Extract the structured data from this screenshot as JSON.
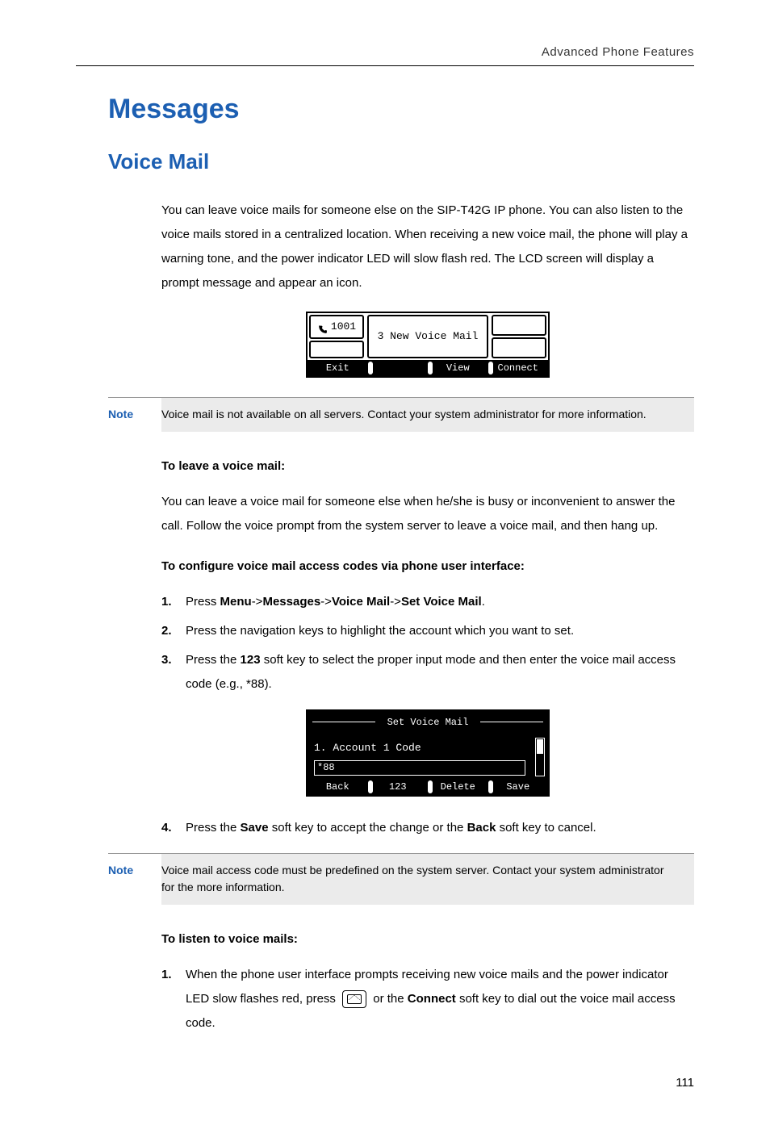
{
  "header": {
    "running": "Advanced Phone Features"
  },
  "h1": "Messages",
  "h2": "Voice Mail",
  "intro_para": "You can leave voice mails for someone else on the SIP-T42G IP phone. You can also listen to the voice mails stored in a centralized location. When receiving a new voice mail, the phone will play a warning tone, and the power indicator LED will slow flash red. The LCD screen will display a prompt message and appear an icon.",
  "lcd1": {
    "account": "1001",
    "message": "3 New Voice Mail",
    "softkeys": [
      "Exit",
      "",
      "View",
      "Connect"
    ]
  },
  "note1": {
    "label": "Note",
    "text": "Voice mail is not available on all servers. Contact your system administrator for more information."
  },
  "leave": {
    "heading": "To leave a voice mail:",
    "para": "You can leave a voice mail for someone else when he/she is busy or inconvenient to answer the call. Follow the voice prompt from the system server to leave a voice mail, and then hang up."
  },
  "config": {
    "heading": "To configure voice mail access codes via phone user interface:",
    "steps": {
      "s1_pre": "Press ",
      "s1_b1": "Menu",
      "s1_t1": "->",
      "s1_b2": "Messages",
      "s1_t2": "->",
      "s1_b3": "Voice Mail",
      "s1_t3": "->",
      "s1_b4": "Set Voice Mail",
      "s1_post": ".",
      "s2": "Press the navigation keys to highlight the account which you want to set.",
      "s3_pre": "Press the ",
      "s3_b1": "123",
      "s3_post": " soft key to select the proper input mode and then enter the voice mail access code (e.g., *88).",
      "s4_pre": "Press the ",
      "s4_b1": "Save",
      "s4_mid": " soft key to accept the change or the ",
      "s4_b2": "Back",
      "s4_post": " soft key to cancel."
    }
  },
  "lcd2": {
    "title": "Set Voice Mail",
    "row_label": "1. Account 1 Code",
    "input_value": "*88",
    "softkeys": [
      "Back",
      "123",
      "Delete",
      "Save"
    ]
  },
  "note2": {
    "label": "Note",
    "text": "Voice mail access code must be predefined on the system server. Contact your system administrator for the more information."
  },
  "listen": {
    "heading": "To listen to voice mails:",
    "s1_pre": "When the phone user interface prompts receiving new voice mails and the power indicator LED slow flashes red, press ",
    "s1_mid": " or the ",
    "s1_b1": "Connect",
    "s1_post": " soft key to dial out the voice mail access code."
  },
  "page_number": "111"
}
